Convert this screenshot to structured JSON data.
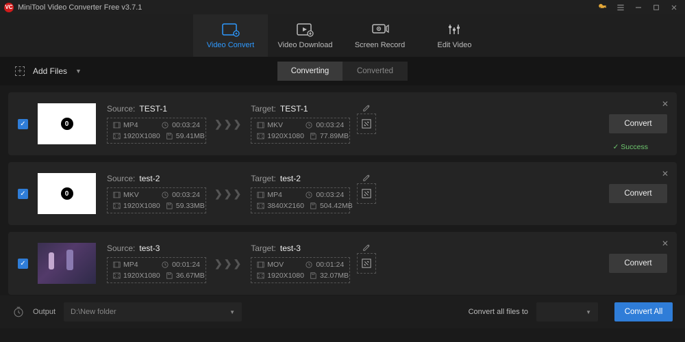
{
  "titlebar": {
    "title": "MiniTool Video Converter Free v3.7.1"
  },
  "mainTabs": [
    {
      "label": "Video Convert",
      "active": true
    },
    {
      "label": "Video Download",
      "active": false
    },
    {
      "label": "Screen Record",
      "active": false
    },
    {
      "label": "Edit Video",
      "active": false
    }
  ],
  "toolbar": {
    "addFiles": "Add Files",
    "segments": {
      "converting": "Converting",
      "converted": "Converted"
    }
  },
  "items": [
    {
      "sourceLabel": "Source:",
      "sourceName": "TEST-1",
      "src": {
        "fmt": "MP4",
        "dur": "00:03:24",
        "res": "1920X1080",
        "size": "59.41MB"
      },
      "targetLabel": "Target:",
      "targetName": "TEST-1",
      "tgt": {
        "fmt": "MKV",
        "dur": "00:03:24",
        "res": "1920X1080",
        "size": "77.89MB"
      },
      "convertLabel": "Convert",
      "success": "Success",
      "thumb": "white"
    },
    {
      "sourceLabel": "Source:",
      "sourceName": "test-2",
      "src": {
        "fmt": "MKV",
        "dur": "00:03:24",
        "res": "1920X1080",
        "size": "59.33MB"
      },
      "targetLabel": "Target:",
      "targetName": "test-2",
      "tgt": {
        "fmt": "MP4",
        "dur": "00:03:24",
        "res": "3840X2160",
        "size": "504.42MB"
      },
      "convertLabel": "Convert",
      "thumb": "white"
    },
    {
      "sourceLabel": "Source:",
      "sourceName": "test-3",
      "src": {
        "fmt": "MP4",
        "dur": "00:01:24",
        "res": "1920X1080",
        "size": "36.67MB"
      },
      "targetLabel": "Target:",
      "targetName": "test-3",
      "tgt": {
        "fmt": "MOV",
        "dur": "00:01:24",
        "res": "1920X1080",
        "size": "32.07MB"
      },
      "convertLabel": "Convert",
      "thumb": "photo"
    }
  ],
  "footer": {
    "outputLabel": "Output",
    "path": "D:\\New folder",
    "convertAllTo": "Convert all files to",
    "convertAll": "Convert All"
  }
}
